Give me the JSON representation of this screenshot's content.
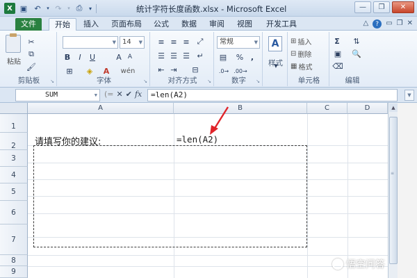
{
  "window": {
    "title": "统计字符长度函数.xlsx - Microsoft Excel",
    "app_icon": "X",
    "controls": [
      "minimize-icon",
      "restore-icon",
      "close-icon"
    ]
  },
  "quick_access": [
    "save-icon",
    "undo-icon",
    "redo-icon",
    "print-preview-icon"
  ],
  "ribbon": {
    "tabs": [
      {
        "label": "文件"
      },
      {
        "label": "开始"
      },
      {
        "label": "插入"
      },
      {
        "label": "页面布局"
      },
      {
        "label": "公式"
      },
      {
        "label": "数据"
      },
      {
        "label": "审阅"
      },
      {
        "label": "视图"
      },
      {
        "label": "开发工具"
      }
    ],
    "active_tab": "开始",
    "groups": {
      "clipboard": {
        "label": "剪贴板",
        "paste": "粘贴"
      },
      "font": {
        "label": "字体",
        "font_name": "",
        "font_size": "14",
        "bold": "B",
        "italic": "I",
        "underline": "U",
        "grow": "A",
        "shrink": "A",
        "wen": "wén",
        "font_color": "A"
      },
      "alignment": {
        "label": "对齐方式"
      },
      "number": {
        "label": "数字",
        "format": "常规",
        "percent": "%",
        "comma": ","
      },
      "styles": {
        "label": "样式",
        "style_char": "A"
      },
      "cells": {
        "label": "单元格",
        "insert": "插入",
        "delete": "删除",
        "format": "格式"
      },
      "editing": {
        "label": "编辑",
        "sum": "Σ"
      }
    }
  },
  "formula_bar": {
    "name_box": "SUM",
    "cancel": "✕",
    "confirm": "✔",
    "fx": "fx",
    "formula": "=len(A2)"
  },
  "sheet": {
    "columns": [
      "A",
      "B",
      "C",
      "D"
    ],
    "rows": [
      "1",
      "2",
      "3",
      "4",
      "5",
      "6",
      "7",
      "8",
      "9"
    ],
    "cells": {
      "A1": "请填写你的建议:",
      "B1": "=len(A2)"
    }
  },
  "watermark": {
    "text": "悟空问答"
  },
  "colors": {
    "file_tab": "#2a8140",
    "arrow": "#e0242a",
    "ribbon": "#e3ecf7"
  }
}
